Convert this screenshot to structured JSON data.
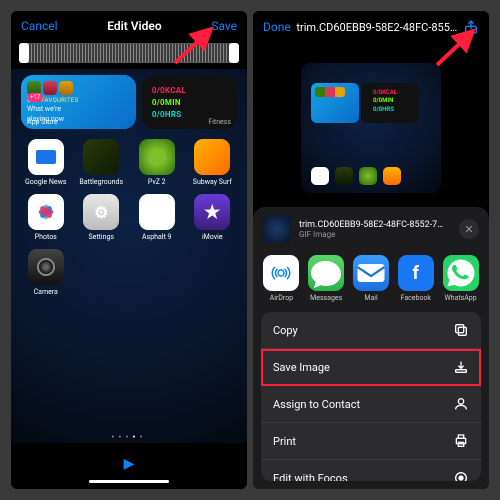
{
  "left": {
    "cancel": "Cancel",
    "title": "Edit Video",
    "save": "Save",
    "widget_appstore": {
      "bonus": "+17",
      "fav": "OUR FAVOURITES",
      "line1": "What we're",
      "line2": "playing now",
      "label": "App Store"
    },
    "widget_fitness": {
      "kcal": "0/0KCAL",
      "min": "0/0MIN",
      "hrs": "0/0HRS",
      "label": "Fitness"
    },
    "apps": [
      {
        "label": "Google News",
        "icon": "gnews"
      },
      {
        "label": "Battlegrounds",
        "icon": "battle"
      },
      {
        "label": "PvZ 2",
        "icon": "pvz"
      },
      {
        "label": "Subway Surf",
        "icon": "subway"
      },
      {
        "label": "Photos",
        "icon": "photos"
      },
      {
        "label": "Settings",
        "icon": "settings"
      },
      {
        "label": "Asphalt 9",
        "icon": "asphalt"
      },
      {
        "label": "iMovie",
        "icon": "imovie"
      },
      {
        "label": "Camera",
        "icon": "camera"
      }
    ]
  },
  "right": {
    "done": "Done",
    "filename": "trim.CD60EBB9-58E2-48FC-855…",
    "sheet_name": "trim.CD60EBB9-58E2-48FC-8552-7…",
    "sheet_sub": "GIF Image",
    "share": [
      {
        "label": "AirDrop",
        "icon": "airdrop"
      },
      {
        "label": "Messages",
        "icon": "msg"
      },
      {
        "label": "Mail",
        "icon": "mail"
      },
      {
        "label": "Facebook",
        "icon": "fb"
      },
      {
        "label": "WhatsApp",
        "icon": "wa"
      }
    ],
    "actions": {
      "copy": "Copy",
      "save_image": "Save Image",
      "assign": "Assign to Contact",
      "print": "Print",
      "edit_focos": "Edit with Focos"
    },
    "thumb": {
      "kcal": "0/0KCAL",
      "min": "0/0MIN",
      "hrs": "0/0HRS"
    }
  }
}
